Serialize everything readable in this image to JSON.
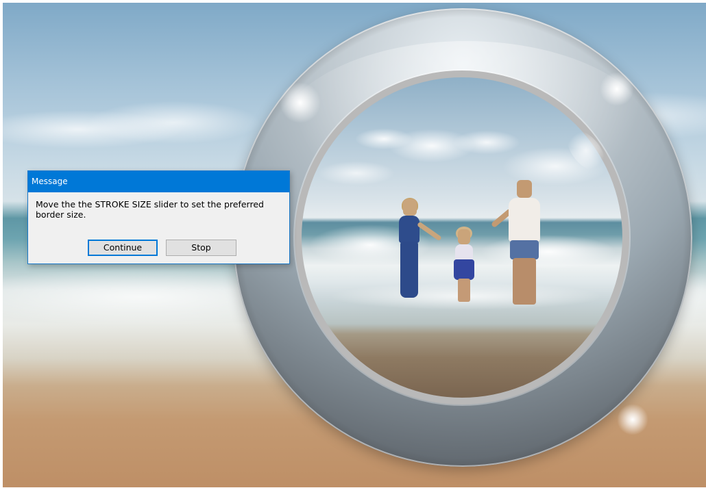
{
  "dialog": {
    "title": "Message",
    "message": "Move the the STROKE SIZE slider to set the preferred border size.",
    "continue_label": "Continue",
    "stop_label": "Stop"
  },
  "colors": {
    "titlebar": "#0078d7",
    "dialog_bg": "#f0f0f0",
    "primary_button_border": "#0078d7"
  }
}
